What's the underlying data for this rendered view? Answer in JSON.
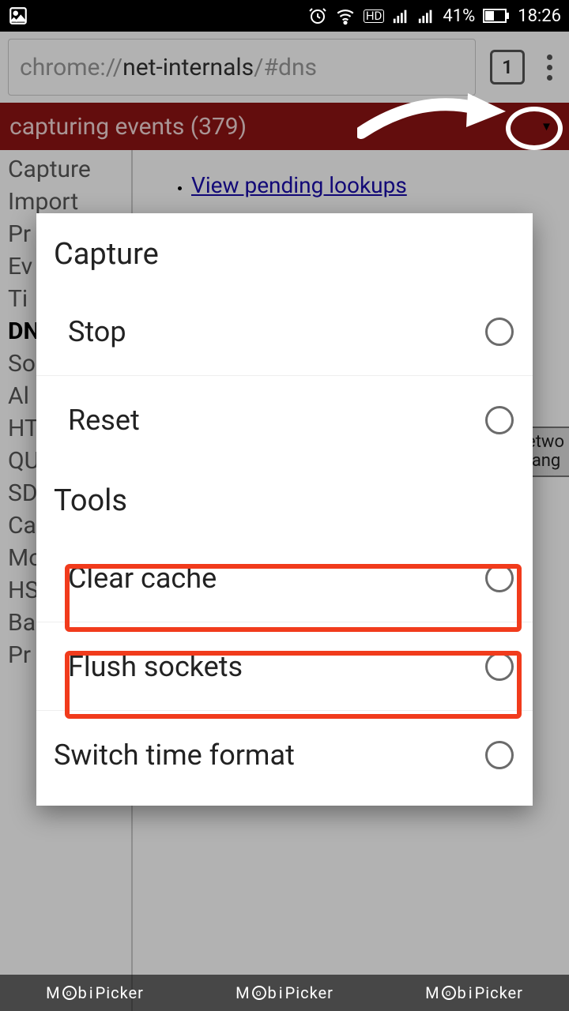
{
  "status": {
    "battery_pct": "41%",
    "time": "18:26",
    "hd": "HD"
  },
  "url": {
    "prefix": "chrome://",
    "host": "net-internals",
    "path": "/#dns"
  },
  "tabs_count": "1",
  "redbar": {
    "text": "capturing events (379)",
    "caret": "▾"
  },
  "sidebar": {
    "items": [
      "Capture",
      "Import",
      "Pr",
      "Ev",
      "Ti",
      "DN",
      "So",
      "Al",
      "HT",
      "QU",
      "SD",
      "Ca",
      "Mo",
      "HS",
      "Ba",
      "Pr"
    ],
    "active_index": 5
  },
  "content": {
    "link": "View pending lookups"
  },
  "info": {
    "line1": "letwo",
    "line2": "hang"
  },
  "dialog": {
    "section1": "Capture",
    "opt_stop": "Stop",
    "opt_reset": "Reset",
    "section2": "Tools",
    "opt_clear": "Clear cache",
    "opt_flush": "Flush sockets",
    "opt_timefmt": "Switch time format"
  },
  "watermark": {
    "a": "M",
    "b": "Picker"
  }
}
